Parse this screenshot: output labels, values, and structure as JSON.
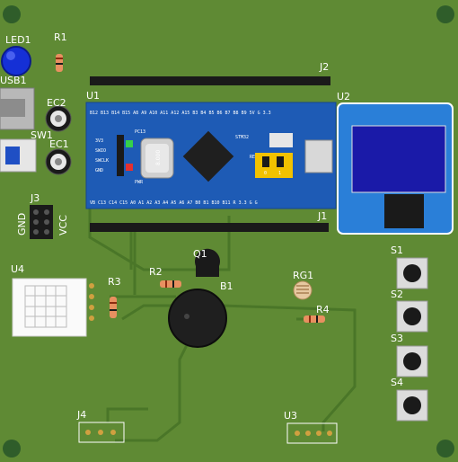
{
  "designators": {
    "led1": "LED1",
    "r1": "R1",
    "usb1": "USB1",
    "ec2": "EC2",
    "sw1": "SW1",
    "ec1": "EC1",
    "j2": "J2",
    "u1": "U1",
    "u2": "U2",
    "j3": "J3",
    "j1": "J1",
    "u4": "U4",
    "r2": "R2",
    "q1": "Q1",
    "r3": "R3",
    "b1": "B1",
    "rg1": "RG1",
    "r4": "R4",
    "s1": "S1",
    "s2": "S2",
    "s3": "S3",
    "s4": "S4",
    "j4": "J4",
    "u3": "U3"
  },
  "j3_pins": {
    "left": "GND",
    "right": "VCC"
  },
  "crystal_label": "8.000",
  "bluepill": {
    "top_pins": "B12 B13 B14 B15 A8 A9 A10 A11 A12 A15 B3 B4 B5 B6 B7 B8 B9 5V G 3.3",
    "bottom_pins": "VB C13 C14 C15 A0 A1 A2 A3 A4 A5 A6 A7 B0 B1 B10 B11 R 3.3 G G",
    "swd_pins": [
      "3V3",
      "SWIO",
      "SWCLK",
      "GND"
    ],
    "pwr_label": "PWR",
    "pc13_label": "PC13",
    "reset_label": "RESET",
    "mcu_label": "STM32",
    "boot_pins": [
      "0",
      "1"
    ]
  },
  "icons": [
    "mounting-hole-icon",
    "led-icon",
    "electrolytic-capacitor-icon",
    "buzzer-icon",
    "transistor-icon",
    "photoresistor-icon",
    "tact-switch-icon",
    "oled-display-icon",
    "usb-connector-icon"
  ],
  "colors": {
    "board": "#5f8a34",
    "pcb_blue": "#1e5bb5",
    "trace": "#4a7628",
    "copper_pad": "#c9a04a",
    "header_black": "#1a1a1a",
    "led_blue": "#1530d6",
    "oled_screen": "#1a1aa8",
    "boot_yellow": "#f2c200"
  }
}
